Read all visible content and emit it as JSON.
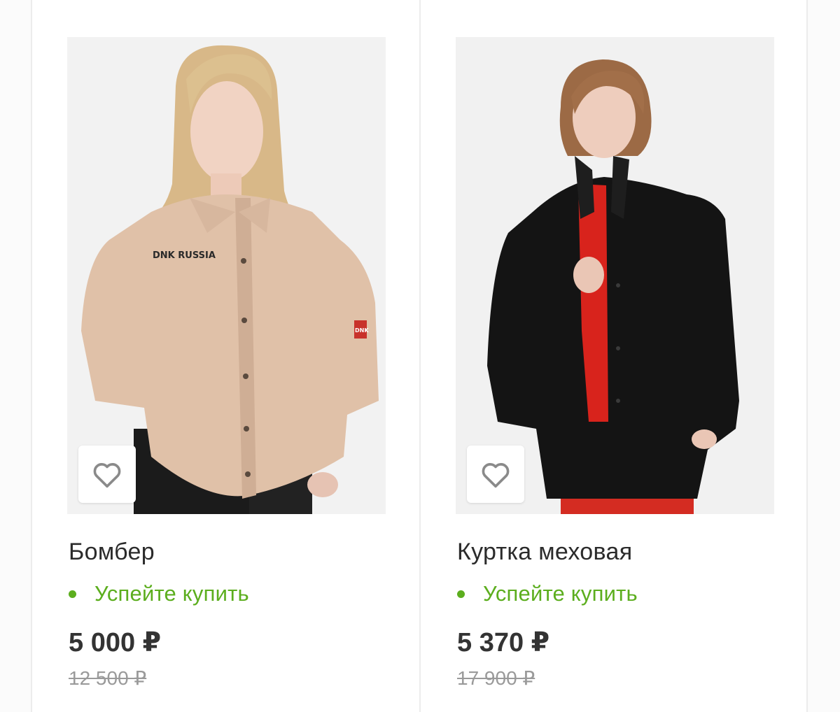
{
  "products": [
    {
      "title": "Бомбер",
      "status": "Успейте купить",
      "price": "5 000 ₽",
      "old_price": "12 500 ₽",
      "logo_patch": "DNK RUSSIA",
      "logo_sleeve": "DNK"
    },
    {
      "title": "Куртка меховая",
      "status": "Успейте купить",
      "price": "5 370 ₽",
      "old_price": "17 900 ₽"
    }
  ],
  "icons": {
    "favorite": "heart-outline-icon"
  },
  "colors": {
    "status_green": "#5cae1e",
    "price_text": "#333333",
    "old_price_text": "#9a9a9a",
    "title_text": "#2b2b2b"
  }
}
